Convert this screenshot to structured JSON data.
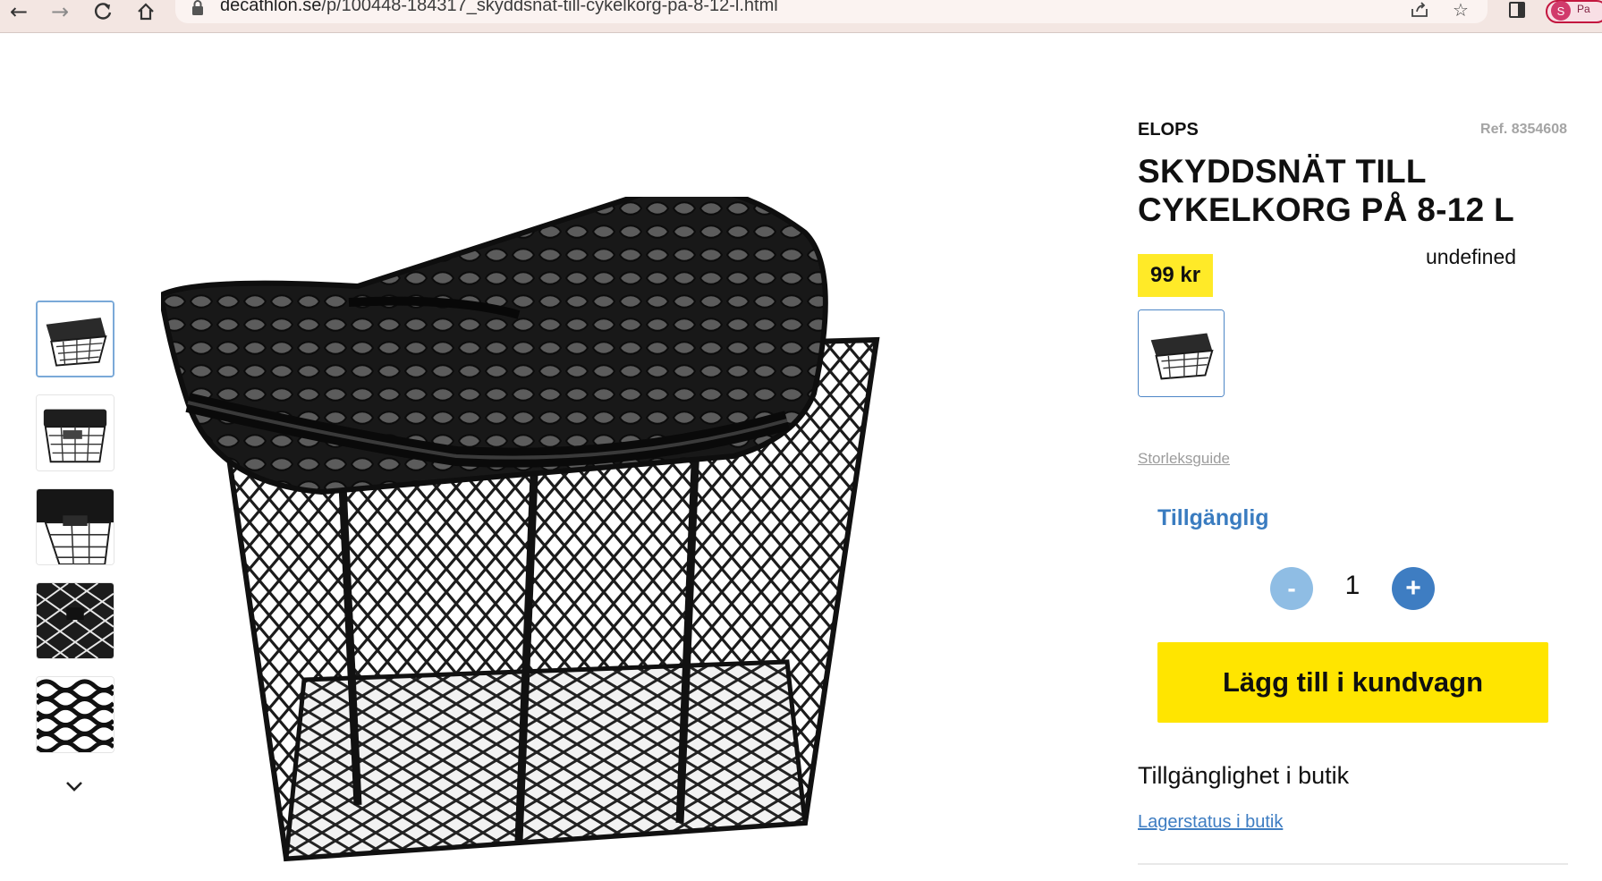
{
  "browser": {
    "url_host": "decathlon.se",
    "url_path": "/p/100448-184317_skyddsnat-till-cykelkorg-pa-8-12-l.html",
    "profile_initial": "S",
    "profile_label": "Pa"
  },
  "product": {
    "brand": "ELOPS",
    "ref": "Ref. 8354608",
    "title": "SKYDDSNÄT TILL CYKELKORG PÅ 8-12 L",
    "price": "99 kr",
    "undefined_text": "undefined",
    "size_guide": "Storleksguide",
    "availability": "Tillgänglig",
    "quantity": {
      "minus": "-",
      "value": "1",
      "plus": "+"
    },
    "add_to_cart": "Lägg till i kundvagn",
    "store_heading": "Tillgänglighet i butik",
    "store_link": "Lagerstatus i butik"
  },
  "gallery": {
    "thumbnail_count": 5,
    "active_index": 0
  },
  "colors": {
    "price_bg": "#ffea28",
    "cart_button": "#ffe500",
    "accent_blue": "#3e7dc2",
    "minus_button": "#8fbde4",
    "browser_chrome": "#f3e6e2"
  },
  "icons": {
    "back": "back-arrow-icon",
    "forward": "forward-arrow-icon",
    "reload": "reload-icon",
    "home": "home-icon",
    "lock": "lock-icon",
    "share": "share-icon",
    "bookmark": "star-icon",
    "sidepanel": "side-panel-icon",
    "thumbnail_next": "chevron-down-icon"
  }
}
